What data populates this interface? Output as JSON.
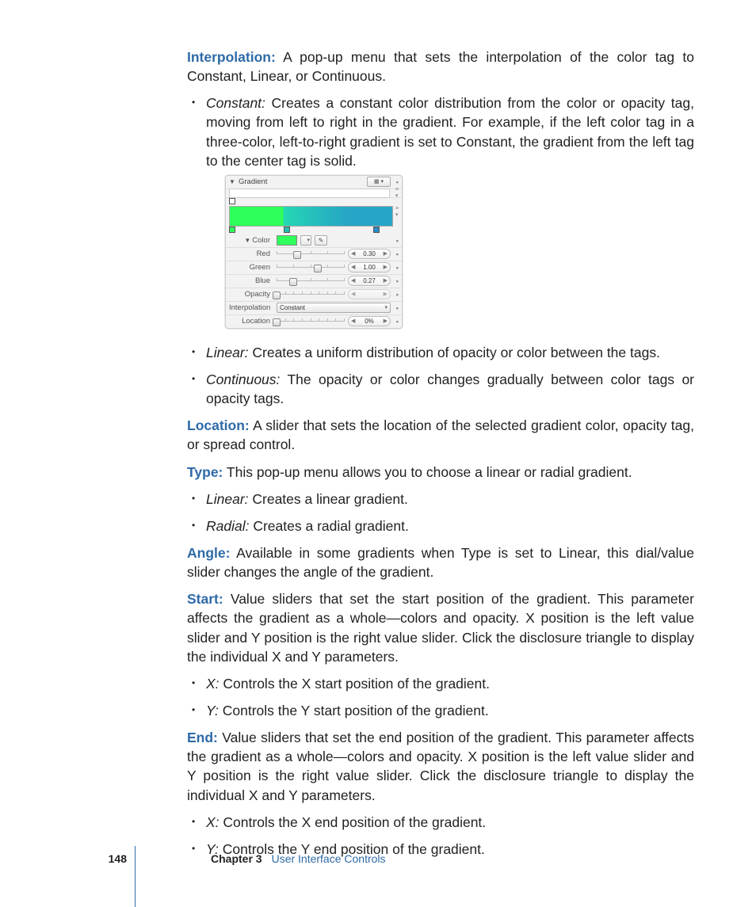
{
  "footer": {
    "page_number": "148",
    "chapter_label": "Chapter 3",
    "chapter_title": "User Interface Controls"
  },
  "interpolation": {
    "term": "Interpolation:",
    "text": "  A pop-up menu that sets the interpolation of the color tag to Constant, Linear, or Continuous.",
    "items": [
      {
        "label": "Constant:",
        "text": "  Creates a constant color distribution from the color or opacity tag, moving from left to right in the gradient. For example, if the left color tag in a three-color, left-to-right gradient is set to Constant, the gradient from the left tag to the center tag is solid."
      },
      {
        "label": "Linear:",
        "text": "  Creates a uniform distribution of opacity or color between the tags."
      },
      {
        "label": "Continuous:",
        "text": "  The opacity or color changes gradually between color tags or opacity tags."
      }
    ]
  },
  "gradient_ui": {
    "header": "Gradient",
    "color_header": "Color",
    "rows": {
      "red": {
        "label": "Red",
        "value": "0.30",
        "pos": 30
      },
      "green": {
        "label": "Green",
        "value": "1.00",
        "pos": 60
      },
      "blue": {
        "label": "Blue",
        "value": "0.27",
        "pos": 24
      },
      "opacity": {
        "label": "Opacity",
        "value": "",
        "pos": 0
      },
      "interpolation": {
        "label": "Interpolation",
        "value": "Constant"
      },
      "location": {
        "label": "Location",
        "value": "0%",
        "pos": 0
      }
    }
  },
  "location": {
    "term": "Location:",
    "text": "  A slider that sets the location of the selected gradient color, opacity tag, or spread control."
  },
  "type": {
    "term": "Type:",
    "text": "  This pop-up menu allows you to choose a linear or radial gradient.",
    "items": [
      {
        "label": "Linear:",
        "text": "  Creates a linear gradient."
      },
      {
        "label": "Radial:",
        "text": "  Creates a radial gradient."
      }
    ]
  },
  "angle": {
    "term": "Angle:",
    "text": "  Available in some gradients when Type is set to Linear, this dial/value slider changes the angle of the gradient."
  },
  "start": {
    "term": "Start:",
    "text": "  Value sliders that set the start position of the gradient. This parameter affects the gradient as a whole—colors and opacity. X position is the left value slider and Y position is the right value slider. Click the disclosure triangle to display the individual X and Y parameters.",
    "items": [
      {
        "label": "X:",
        "text": "  Controls the X start position of the gradient."
      },
      {
        "label": "Y:",
        "text": "  Controls the Y start position of the gradient."
      }
    ]
  },
  "end": {
    "term": "End:",
    "text": "  Value sliders that set the end position of the gradient. This parameter affects the gradient as a whole—colors and opacity. X position is the left value slider and Y position is the right value slider. Click the disclosure triangle to display the individual X and Y parameters.",
    "items": [
      {
        "label": "X:",
        "text": "  Controls the X end position of the gradient."
      },
      {
        "label": "Y:",
        "text": "  Controls the Y end position of the gradient."
      }
    ]
  }
}
